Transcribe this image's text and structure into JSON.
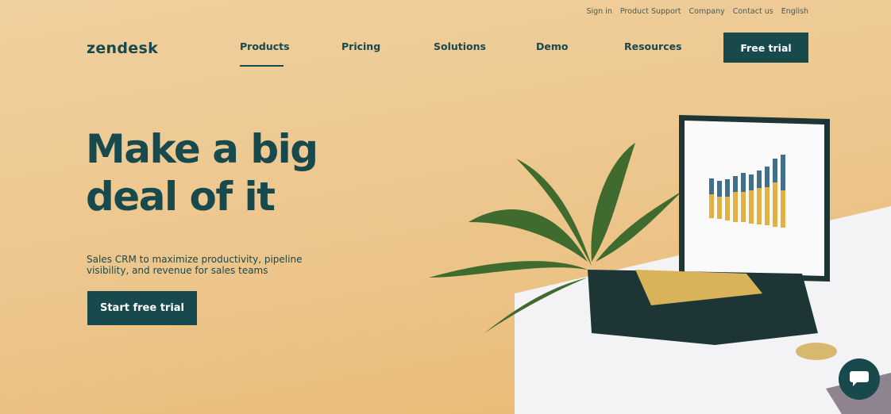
{
  "utility_nav": [
    "Sign in",
    "Product Support",
    "Company",
    "Contact us",
    "English"
  ],
  "logo": "zendesk",
  "nav": {
    "items": [
      "Products",
      "Pricing",
      "Solutions",
      "Demo",
      "Resources"
    ],
    "active": "Products",
    "cta": "Free trial"
  },
  "hero": {
    "title_line1": "Make a big",
    "title_line2": "deal of it",
    "subtitle": "Sales CRM to maximize productivity, pipeline visibility, and revenue for sales teams",
    "cta": "Start free trial"
  },
  "colors": {
    "brand": "#17494d",
    "background": "#ecc489"
  },
  "icons": {
    "chat": "chat-bubble-icon"
  }
}
